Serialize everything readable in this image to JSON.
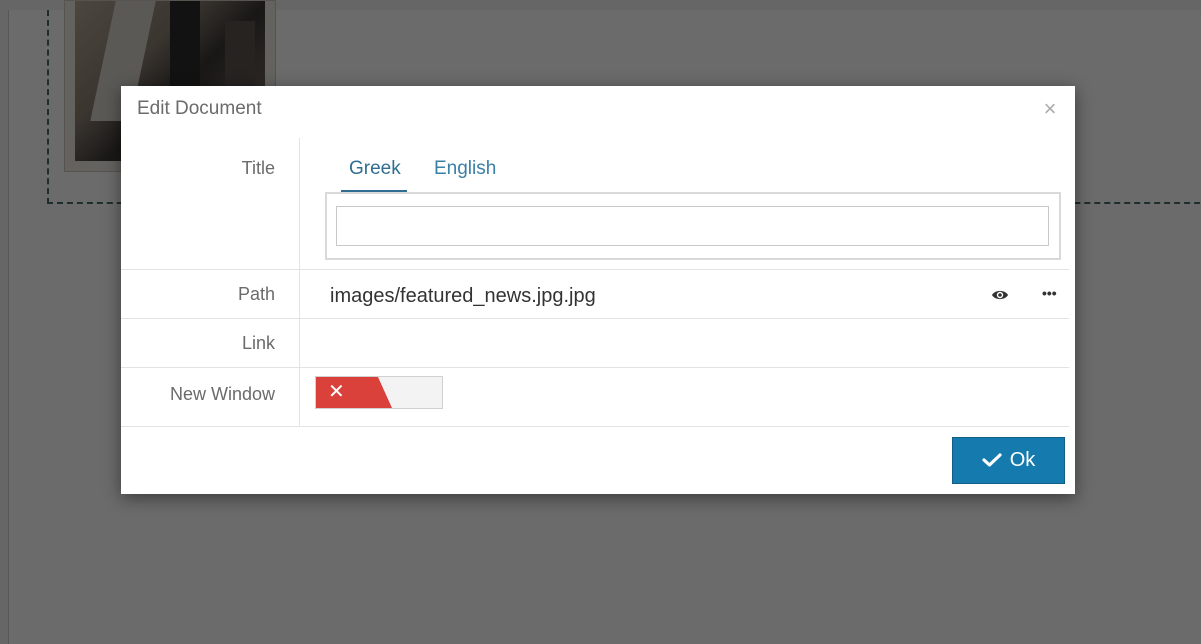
{
  "dialog": {
    "title": "Edit Document",
    "close_glyph": "×",
    "fields": {
      "title_label": "Title",
      "path_label": "Path",
      "link_label": "Link",
      "new_window_label": "New Window"
    },
    "title_tabs": [
      {
        "label": "Greek",
        "active": true
      },
      {
        "label": "English",
        "active": false
      }
    ],
    "title_value": "",
    "path_value": "images/featured_news.jpg.jpg",
    "path_icons": [
      "eye-icon",
      "more-icon"
    ],
    "more_glyph": "•••",
    "new_window": {
      "enabled": false,
      "off_glyph": "✕"
    },
    "ok_label": "Ok"
  },
  "colors": {
    "accent": "#2f6e92",
    "button": "#157aae",
    "toggle_off": "#d9413a"
  }
}
